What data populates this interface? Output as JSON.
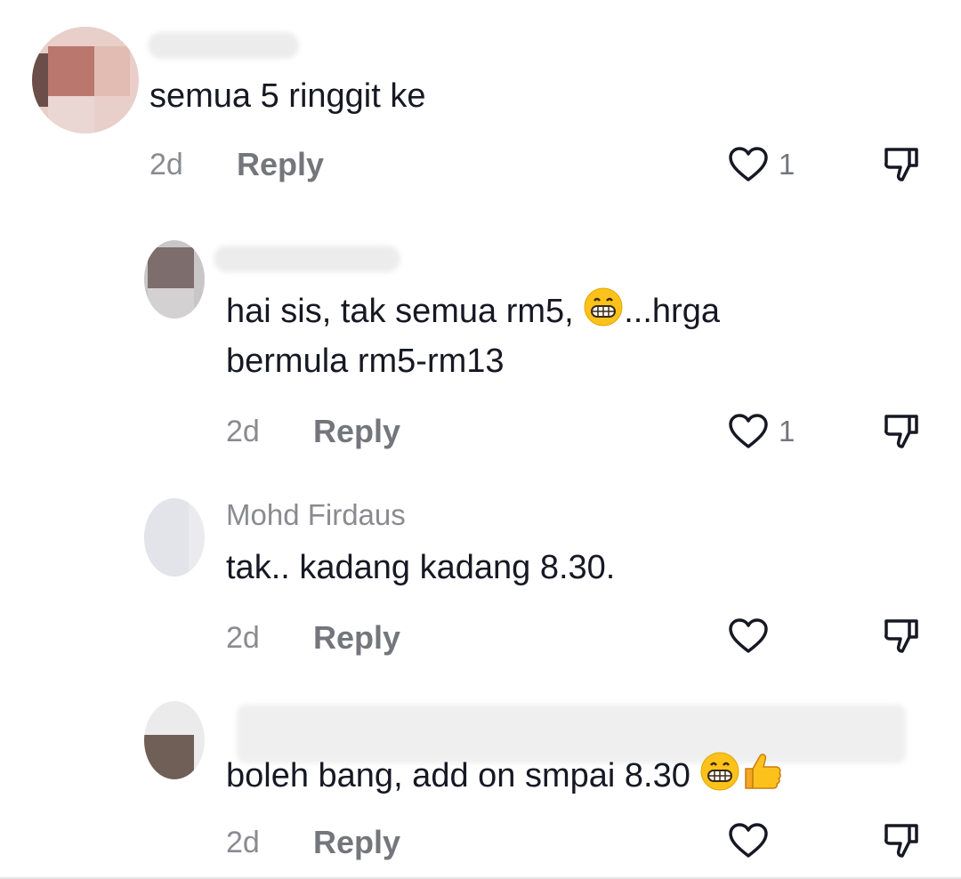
{
  "comments": [
    {
      "text": "semua 5 ringgit ke",
      "time": "2d",
      "reply_label": "Reply",
      "like_count": "1",
      "author": ""
    },
    {
      "text_line1": "hai sis, tak semua rm5, ",
      "text_line1_end": "...hrga",
      "text_line2": "bermula rm5-rm13",
      "time": "2d",
      "reply_label": "Reply",
      "like_count": "1",
      "author": "",
      "emoji": "grinning-face-icon"
    },
    {
      "author": "Mohd Firdaus",
      "text": "tak.. kadang kadang 8.30.",
      "time": "2d",
      "reply_label": "Reply",
      "like_count": ""
    },
    {
      "author": "",
      "text": "boleh bang, add on smpai 8.30 ",
      "time": "2d",
      "reply_label": "Reply",
      "like_count": "",
      "emojis": [
        "grinning-face-icon",
        "thumbs-up-icon"
      ]
    }
  ],
  "colors": {
    "text": "#161823",
    "muted": "#8a8b91",
    "icon": "#161823"
  }
}
